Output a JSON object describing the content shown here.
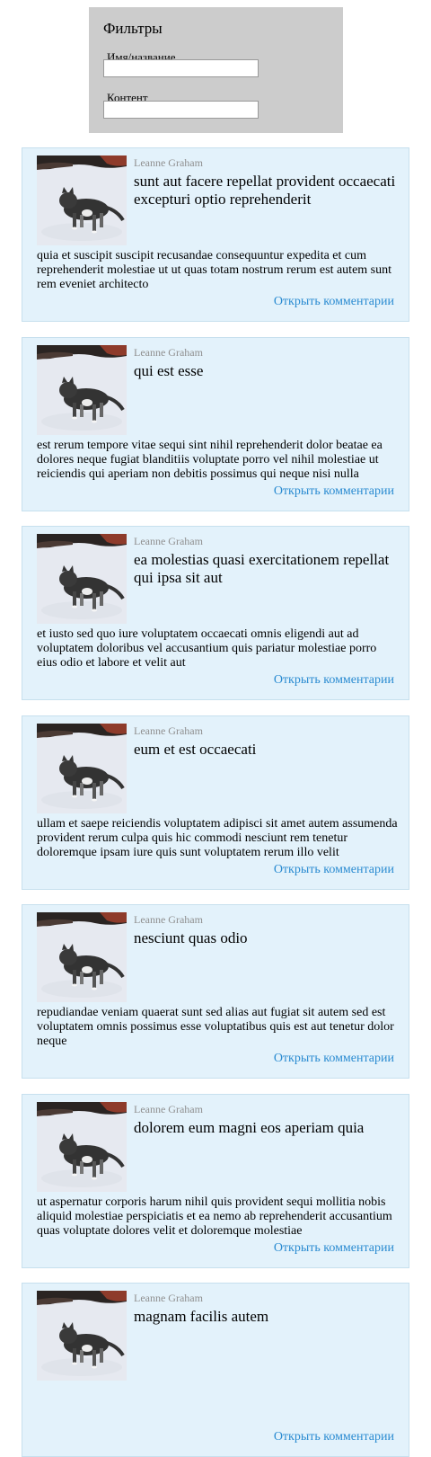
{
  "filters": {
    "title": "Фильтры",
    "name_label": "Имя/название",
    "name_value": "",
    "content_label": "Контент",
    "content_value": ""
  },
  "comments_link": "Открыть комментарии",
  "posts": [
    {
      "author": "Leanne Graham",
      "title": "sunt aut facere repellat provident occaecati excepturi optio reprehenderit",
      "body": "quia et suscipit suscipit recusandae consequuntur expedita et cum reprehenderit molestiae ut ut quas totam nostrum rerum est autem sunt rem eveniet architecto"
    },
    {
      "author": "Leanne Graham",
      "title": "qui est esse",
      "body": "est rerum tempore vitae sequi sint nihil reprehenderit dolor beatae ea dolores neque fugiat blanditiis voluptate porro vel nihil molestiae ut reiciendis qui aperiam non debitis possimus qui neque nisi nulla"
    },
    {
      "author": "Leanne Graham",
      "title": "ea molestias quasi exercitationem repellat qui ipsa sit aut",
      "body": "et iusto sed quo iure voluptatem occaecati omnis eligendi aut ad voluptatem doloribus vel accusantium quis pariatur molestiae porro eius odio et labore et velit aut"
    },
    {
      "author": "Leanne Graham",
      "title": "eum et est occaecati",
      "body": "ullam et saepe reiciendis voluptatem adipisci sit amet autem assumenda provident rerum culpa quis hic commodi nesciunt rem tenetur doloremque ipsam iure quis sunt voluptatem rerum illo velit"
    },
    {
      "author": "Leanne Graham",
      "title": "nesciunt quas odio",
      "body": "repudiandae veniam quaerat sunt sed alias aut fugiat sit autem sed est voluptatem omnis possimus esse voluptatibus quis est aut tenetur dolor neque"
    },
    {
      "author": "Leanne Graham",
      "title": "dolorem eum magni eos aperiam quia",
      "body": "ut aspernatur corporis harum nihil quis provident sequi mollitia nobis aliquid molestiae perspiciatis et ea nemo ab reprehenderit accusantium quas voluptate dolores velit et doloremque molestiae"
    },
    {
      "author": "Leanne Graham",
      "title": "magnam facilis autem",
      "body": ""
    }
  ]
}
